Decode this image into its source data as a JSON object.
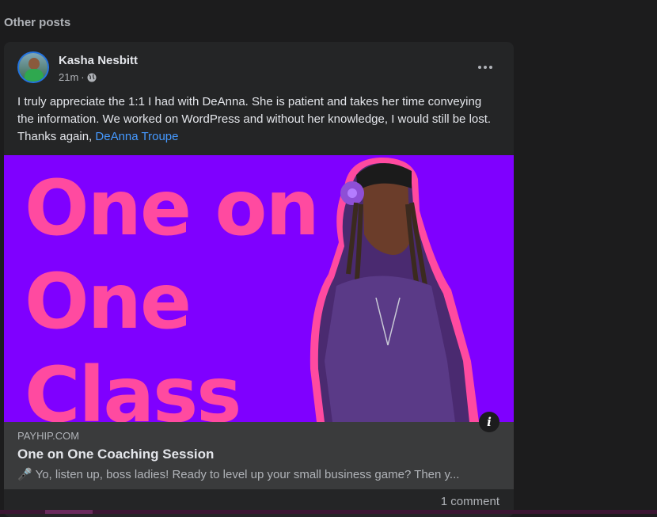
{
  "section": {
    "title": "Other posts"
  },
  "post": {
    "author": "Kasha Nesbitt",
    "time": "21m",
    "separator": "·",
    "privacy_icon": "globe-icon",
    "text_main": "I truly appreciate the 1:1 I had with DeAnna. She is patient and takes her time conveying the information. We worked on WordPress and without her knowledge, I would still be lost. Thanks again, ",
    "mention": "DeAnna Troupe",
    "more_icon": "more-options-icon"
  },
  "hero": {
    "line1": "One on",
    "line2": "One",
    "line3": "Class",
    "background": "#7f00ff",
    "text_color": "#ff4aa0"
  },
  "link_preview": {
    "domain": "PAYHIP.COM",
    "title": "One on One Coaching Session",
    "description": "🎤 Yo, listen up, boss ladies! Ready to level up your small business game? Then y...",
    "info_icon_glyph": "i"
  },
  "footer": {
    "comments": "1 comment"
  },
  "colors": {
    "card": "#242526",
    "page": "#1c1c1d",
    "link": "#4599ff"
  }
}
